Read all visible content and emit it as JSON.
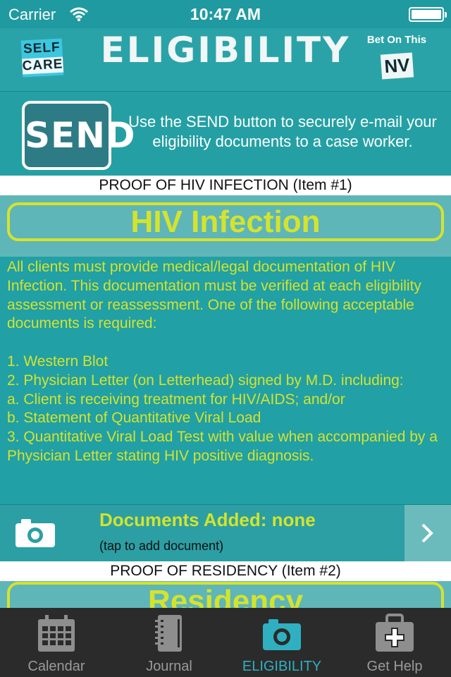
{
  "status_bar": {
    "carrier": "Carrier",
    "time": "10:47 AM"
  },
  "header": {
    "logo": {
      "line1": "SELF",
      "line2": "CARE"
    },
    "title": "ELIGIBILITY",
    "partner_label": "Bet On This",
    "partner_badge": "NV"
  },
  "send": {
    "button_label": "SEND",
    "instructions": "Use the SEND button to securely e-mail your eligibility documents to a case worker."
  },
  "items": [
    {
      "section_title": "PROOF OF HIV INFECTION (Item #1)",
      "pill_label": "HIV Infection",
      "description": "All clients must provide medical/legal documentation of HIV Infection. This documentation must be verified at each eligibility assessment or reassessment. One of the following acceptable documents is required:\n\n1. Western Blot\n2. Physician Letter (on Letterhead) signed by M.D. including:\na. Client is receiving treatment for HIV/AIDS; and/or\nb. Statement of Quantitative Viral Load\n3. Quantitative Viral Load Test with value when accompanied by a Physician Letter stating HIV positive diagnosis.",
      "documents_added": "Documents Added: none",
      "tap_hint": "(tap to add document)"
    },
    {
      "section_title": "PROOF OF RESIDENCY (Item #2)",
      "pill_label": "Residency"
    }
  ],
  "tabs": [
    {
      "label": "Calendar",
      "icon": "calendar-icon",
      "active": false
    },
    {
      "label": "Journal",
      "icon": "journal-icon",
      "active": false
    },
    {
      "label": "ELIGIBILITY",
      "icon": "camera-icon",
      "active": true
    },
    {
      "label": "Get Help",
      "icon": "medical-kit-icon",
      "active": false
    }
  ],
  "colors": {
    "teal": "#25a0a4",
    "accent_yellow": "#d4e32d",
    "active_tab": "#2fb0c0",
    "tabbar": "#2b2b2b"
  }
}
